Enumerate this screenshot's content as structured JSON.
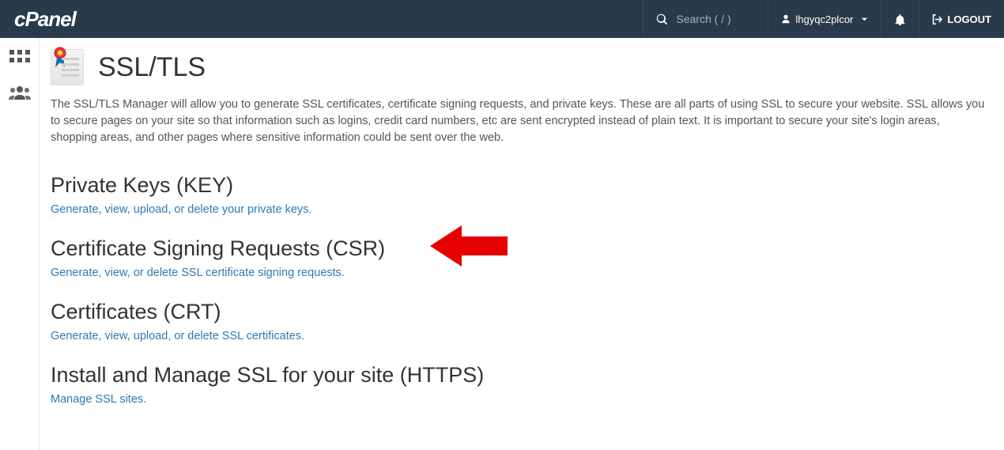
{
  "header": {
    "logo": "cPanel",
    "search_placeholder": "Search ( / )",
    "username": "lhgyqc2plcor",
    "logout": "LOGOUT"
  },
  "page": {
    "title": "SSL/TLS",
    "intro": "The SSL/TLS Manager will allow you to generate SSL certificates, certificate signing requests, and private keys. These are all parts of using SSL to secure your website. SSL allows you to secure pages on your site so that information such as logins, credit card numbers, etc are sent encrypted instead of plain text. It is important to secure your site's login areas, shopping areas, and other pages where sensitive information could be sent over the web."
  },
  "sections": {
    "key": {
      "heading": "Private Keys (KEY)",
      "link": "Generate, view, upload, or delete your private keys."
    },
    "csr": {
      "heading": "Certificate Signing Requests (CSR)",
      "link": "Generate, view, or delete SSL certificate signing requests."
    },
    "crt": {
      "heading": "Certificates (CRT)",
      "link": "Generate, view, upload, or delete SSL certificates."
    },
    "install": {
      "heading": "Install and Manage SSL for your site (HTTPS)",
      "link": "Manage SSL sites."
    }
  }
}
